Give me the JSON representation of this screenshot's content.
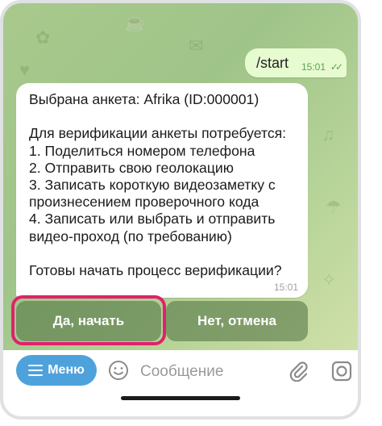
{
  "chat": {
    "outgoing": {
      "text": "/start",
      "time": "15:01",
      "status": "read"
    },
    "incoming": {
      "text": "Выбрана анкета: Afrika (ID:000001)\n\nДля верификации анкеты потребуется:\n1. Поделиться номером телефона\n2. Отправить свою геолокацию\n3. Записать короткую видеозаметку с\nпроизнесением проверочного кода\n4. Записать или выбрать и отправить\nвидео-проход (по требованию)\n\nГотовы начать процесс верификации?",
      "time": "15:01"
    }
  },
  "keyboard": {
    "yes_label": "Да, начать",
    "no_label": "Нет, отмена"
  },
  "input_bar": {
    "menu_label": "Меню",
    "placeholder": "Сообщение"
  },
  "colors": {
    "highlight": "#e0216c",
    "menu_button": "#4ea2dc",
    "outgoing_bubble": "#e7fbd0",
    "check_marks": "#5da054"
  },
  "icons": [
    "menu-icon",
    "emoji-icon",
    "attach-icon",
    "camera-icon",
    "double-check-icon"
  ]
}
